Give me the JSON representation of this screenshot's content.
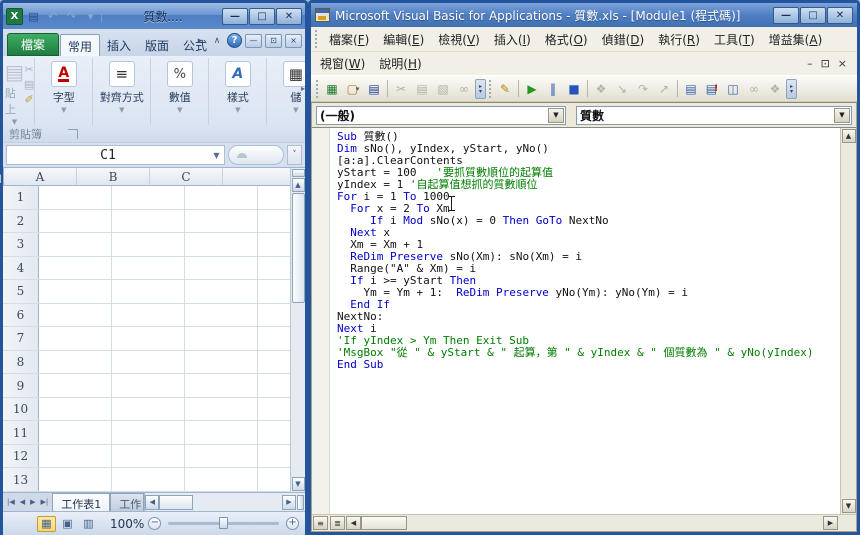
{
  "excel": {
    "title": "質數....",
    "qat": [
      {
        "n": "excel-app-icon",
        "g": "X",
        "cls": "app"
      },
      {
        "n": "save-button",
        "g": "▤",
        "cls": "save"
      },
      {
        "n": "undo-button",
        "g": "↶",
        "cls": "dim"
      },
      {
        "n": "redo-button",
        "g": "↷",
        "cls": "dim"
      },
      {
        "n": "qat-customize-button",
        "g": "▾",
        "cls": "dim"
      }
    ],
    "window_buttons": {
      "minimize": "—",
      "maximize": "□",
      "close": "✕"
    },
    "file_tab": "檔案",
    "ribbon_tabs": [
      "常用",
      "插入",
      "版面",
      "公式"
    ],
    "ribbon": {
      "paste_label": "貼上",
      "small_icons": [
        {
          "n": "cut-icon",
          "g": "✂",
          "cls": ""
        },
        {
          "n": "copy-icon",
          "g": "▤",
          "cls": ""
        },
        {
          "n": "format-painter-icon",
          "g": "✐",
          "cls": "brush"
        }
      ],
      "groups": [
        {
          "label": "字型",
          "icon": "font-icon",
          "glyph": "A",
          "cls": "gi-font"
        },
        {
          "label": "對齊方式",
          "icon": "alignment-icon",
          "glyph": "≡",
          "cls": "gi-align"
        },
        {
          "label": "數值",
          "icon": "number-icon",
          "glyph": "%",
          "cls": "gi-num"
        },
        {
          "label": "樣式",
          "icon": "styles-icon",
          "glyph": "A",
          "cls": "gi-style"
        },
        {
          "label": "儲",
          "icon": "cells-icon",
          "glyph": "▦",
          "cls": "gi-align"
        }
      ],
      "clipboard_label": "剪貼簿"
    },
    "name_box": "C1",
    "grid": {
      "columns": [
        "A",
        "B",
        "C"
      ],
      "rows": [
        "1",
        "2",
        "3",
        "4",
        "5",
        "6",
        "7",
        "8",
        "9",
        "10",
        "11",
        "12",
        "13"
      ]
    },
    "sheet_tabs": [
      {
        "label": "工作表1",
        "active": true
      },
      {
        "label": "工作",
        "active": false
      }
    ],
    "sheet_nav": [
      "|◀",
      "◀",
      "▶",
      "▶|"
    ],
    "status": {
      "views": [
        {
          "n": "normal-view-button",
          "g": "▦",
          "active": true
        },
        {
          "n": "page-layout-view-button",
          "g": "▣",
          "active": false
        },
        {
          "n": "page-break-view-button",
          "g": "▥",
          "active": false
        }
      ],
      "zoom": "100%"
    }
  },
  "vba": {
    "title": "Microsoft Visual Basic for Applications - 質數.xls - [Module1 (程式碼)]",
    "window_buttons": {
      "minimize": "—",
      "maximize": "□",
      "close": "✕"
    },
    "menu1": [
      "檔案(F)",
      "編輯(E)",
      "檢視(V)",
      "插入(I)",
      "格式(O)",
      "偵錯(D)",
      "執行(R)",
      "工具(T)",
      "增益集(A)"
    ],
    "menu2": [
      "視窗(W)",
      "說明(H)"
    ],
    "mdi_buttons": {
      "minimize": "–",
      "restore": "⊡",
      "close": "×"
    },
    "toolbar": [
      {
        "grip": true
      },
      {
        "n": "view-excel-button",
        "g": "▦",
        "c": "#1a7a2e"
      },
      {
        "n": "insert-userform-button",
        "g": "▢",
        "c": "#b07818",
        "drop": true
      },
      {
        "n": "save-button",
        "g": "▤",
        "c": "#1f3f9f"
      },
      {
        "sep": true
      },
      {
        "n": "cut-button",
        "g": "✂",
        "dis": true
      },
      {
        "n": "copy-button",
        "g": "▤",
        "dis": true
      },
      {
        "n": "paste-button",
        "g": "▧",
        "dis": true
      },
      {
        "n": "find-button",
        "g": "∞",
        "dis": true
      },
      {
        "chip": true
      },
      {
        "grip": true
      },
      {
        "n": "design-mode-button",
        "g": "✎",
        "c": "#b8860b"
      },
      {
        "sep": true
      },
      {
        "n": "run-button",
        "g": "▶",
        "c": "#1f9a1f"
      },
      {
        "n": "break-button",
        "g": "‖",
        "c": "#2255bb"
      },
      {
        "n": "reset-button",
        "g": "■",
        "c": "#2255bb"
      },
      {
        "sep": true
      },
      {
        "n": "design-hand-button",
        "g": "❖",
        "dis": true
      },
      {
        "n": "step-into-button",
        "g": "↘",
        "dis": true
      },
      {
        "n": "step-over-button",
        "g": "↷",
        "dis": true
      },
      {
        "n": "step-out-button",
        "g": "↗",
        "dis": true
      },
      {
        "sep": true
      },
      {
        "n": "locals-window-button",
        "g": "▤",
        "c": "#2f5fae"
      },
      {
        "n": "immediate-window-button",
        "g": "▤",
        "c": "#2f5fae",
        "badge": "!"
      },
      {
        "n": "object-browser-button",
        "g": "◫",
        "c": "#2f5fae"
      },
      {
        "n": "watch-window-button",
        "g": "∞",
        "dis": true
      },
      {
        "n": "call-stack-button",
        "g": "❖",
        "dis": true
      },
      {
        "chip": true
      }
    ],
    "dropdown_left": "(一般)",
    "dropdown_right": "質數",
    "code_lines": [
      [
        [
          "k",
          "Sub"
        ],
        [
          "n",
          " 質數()"
        ]
      ],
      [
        [
          "k",
          "Dim"
        ],
        [
          "n",
          " sNo(), yIndex, yStart, yNo()"
        ]
      ],
      [
        [
          "n",
          "[a:a].ClearContents"
        ]
      ],
      [
        [
          "n",
          "yStart = 100   "
        ],
        [
          "c",
          "'要抓質數順位的起算值"
        ]
      ],
      [
        [
          "n",
          "yIndex = 1 "
        ],
        [
          "c",
          "'自起算值想抓的質數順位"
        ]
      ],
      [
        [
          "k",
          "For"
        ],
        [
          "n",
          " i = 1 "
        ],
        [
          "k",
          "To"
        ],
        [
          "n",
          " 1000"
        ]
      ],
      [
        [
          "n",
          "  "
        ],
        [
          "k",
          "For"
        ],
        [
          "n",
          " x = 2 "
        ],
        [
          "k",
          "To"
        ],
        [
          "n",
          " Xm"
        ]
      ],
      [
        [
          "n",
          "     "
        ],
        [
          "k",
          "If"
        ],
        [
          "n",
          " i "
        ],
        [
          "k",
          "Mod"
        ],
        [
          "n",
          " sNo(x) = 0 "
        ],
        [
          "k",
          "Then"
        ],
        [
          "n",
          " "
        ],
        [
          "k",
          "GoTo"
        ],
        [
          "n",
          " NextNo"
        ]
      ],
      [
        [
          "n",
          "  "
        ],
        [
          "k",
          "Next"
        ],
        [
          "n",
          " x"
        ]
      ],
      [
        [
          "n",
          "  Xm = Xm + 1"
        ]
      ],
      [
        [
          "n",
          "  "
        ],
        [
          "k",
          "ReDim Preserve"
        ],
        [
          "n",
          " sNo(Xm): sNo(Xm) = i"
        ]
      ],
      [
        [
          "n",
          "  Range(\"A\" & Xm) = i"
        ]
      ],
      [
        [
          "n",
          "  "
        ],
        [
          "k",
          "If"
        ],
        [
          "n",
          " i >= yStart "
        ],
        [
          "k",
          "Then"
        ]
      ],
      [
        [
          "n",
          "    Ym = Ym + 1:  "
        ],
        [
          "k",
          "ReDim Preserve"
        ],
        [
          "n",
          " yNo(Ym): yNo(Ym) = i"
        ]
      ],
      [
        [
          "n",
          "  "
        ],
        [
          "k",
          "End If"
        ]
      ],
      [
        [
          "n",
          "NextNo:"
        ]
      ],
      [
        [
          "k",
          "Next"
        ],
        [
          "n",
          " i"
        ]
      ],
      [
        [
          "c",
          "'If yIndex > Ym Then Exit Sub"
        ]
      ],
      [
        [
          "c",
          "'MsgBox \"從 \" & yStart & \" 起算，第 \" & yIndex & \" 個質數為 \" & yNo(yIndex)"
        ]
      ],
      [
        [
          "k",
          "End Sub"
        ]
      ]
    ]
  },
  "colors": {
    "titlebar_blue": "#4f7ec3",
    "file_tab_green": "#2d9a4e",
    "keyword_blue": "#0000c8",
    "comment_green": "#007d00",
    "run_green": "#1f9a1f",
    "active_view_highlight": "#fcd672"
  }
}
